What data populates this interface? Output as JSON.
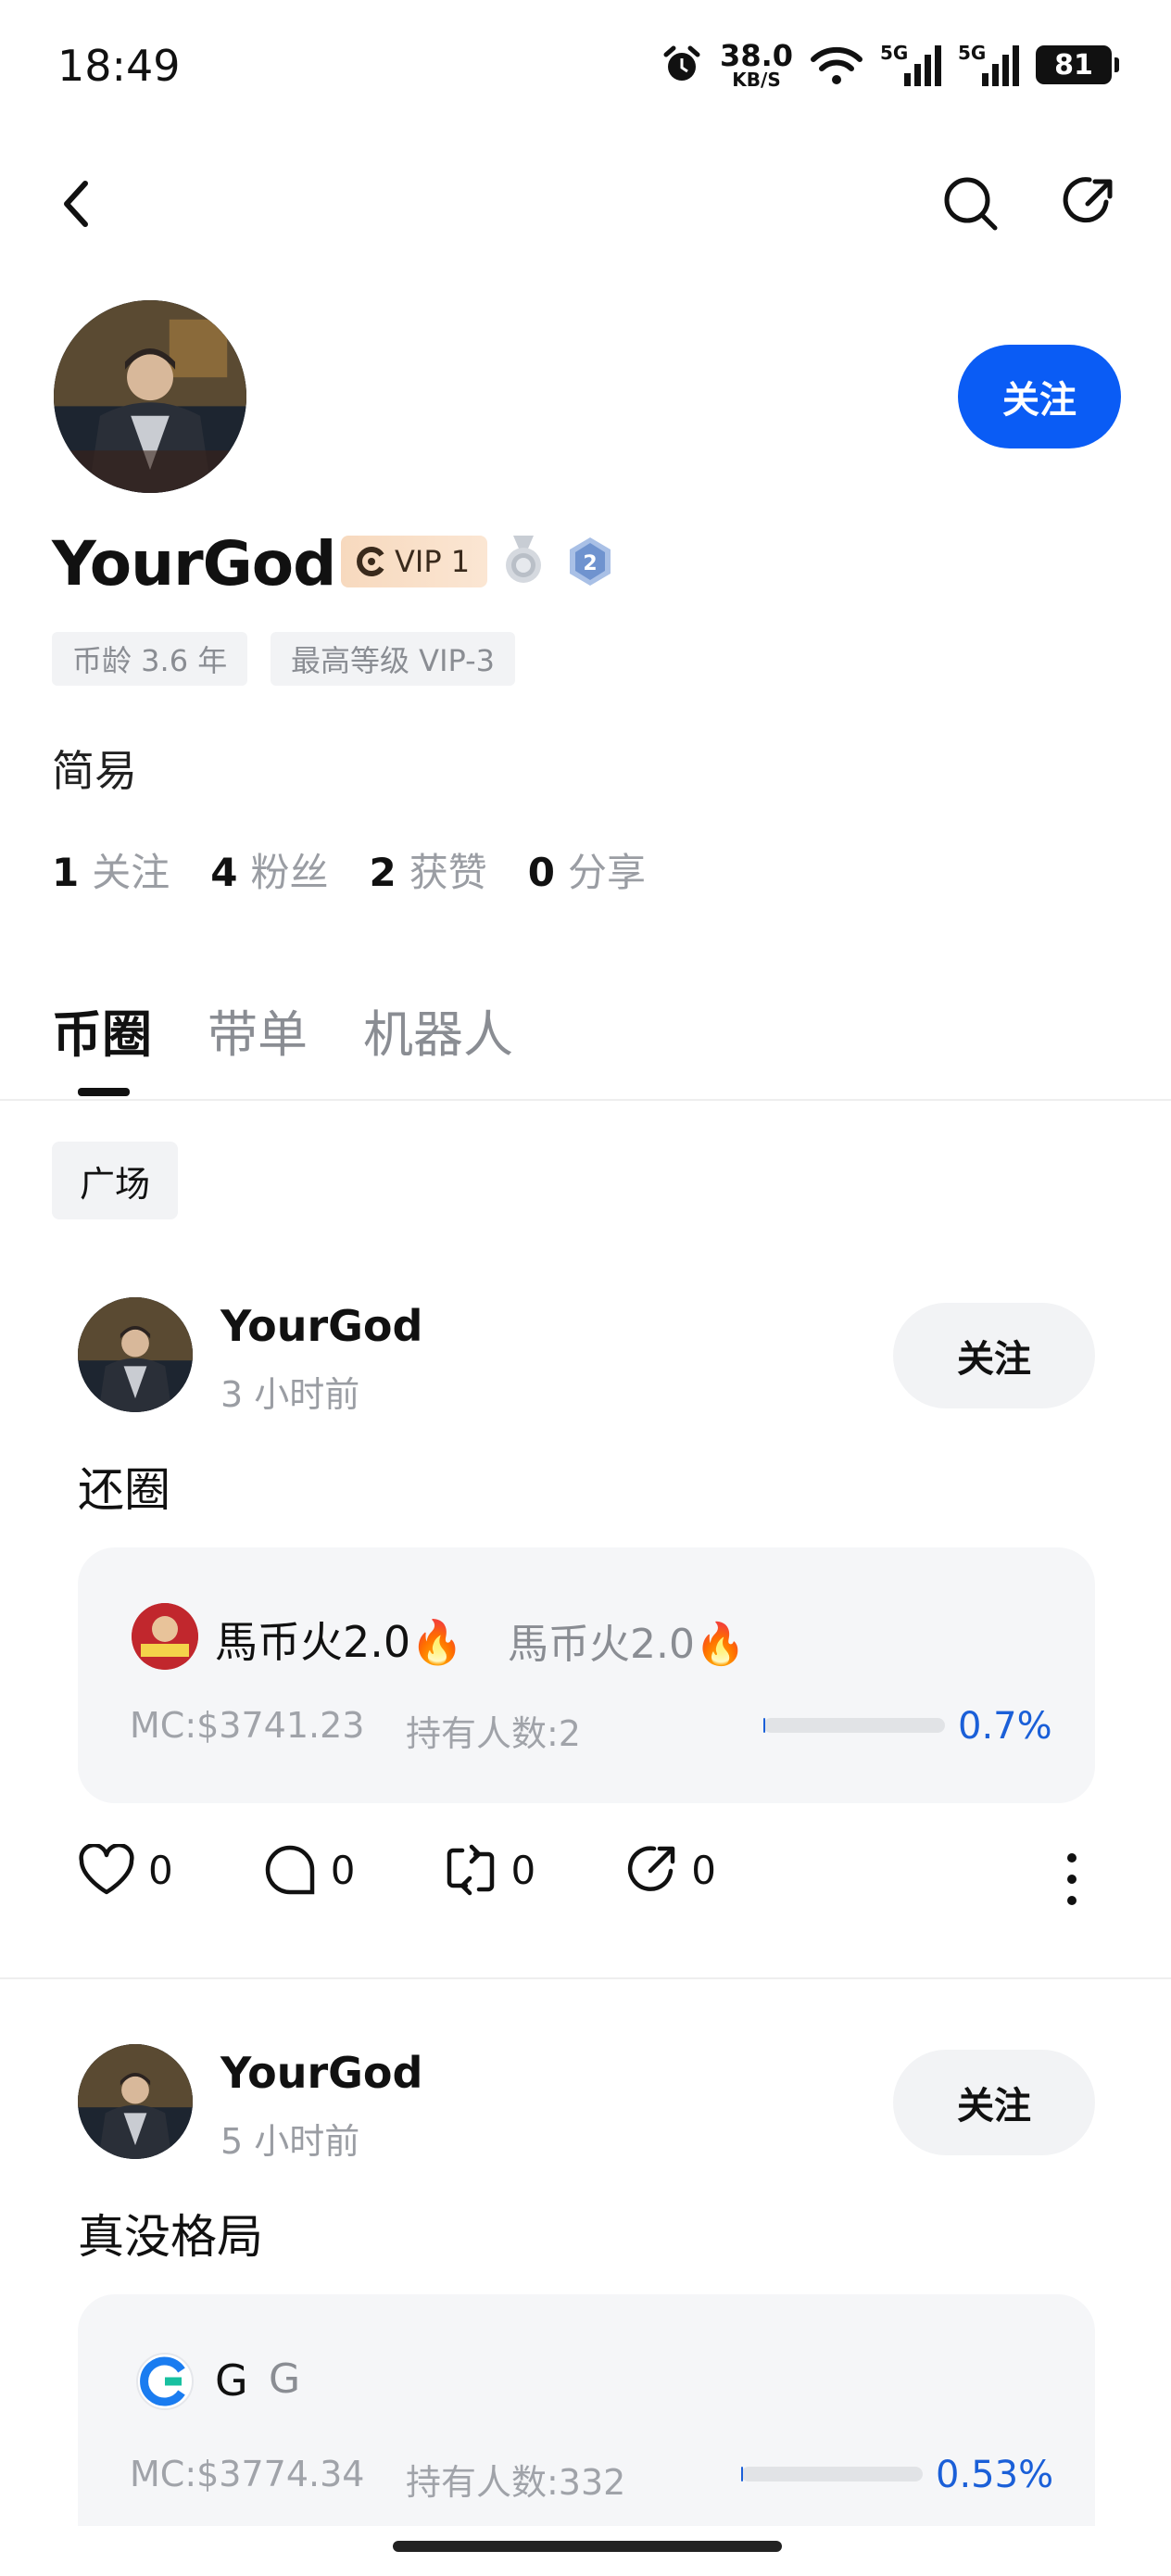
{
  "status_bar": {
    "time": "18:49",
    "net_speed": "38.0",
    "net_unit": "KB/S",
    "signal1": "5G",
    "signal2": "5G",
    "battery": "81"
  },
  "profile": {
    "username": "YourGod",
    "vip_label": "VIP 1",
    "level_badge": "2",
    "tags": [
      "币龄 3.6 年",
      "最高等级 VIP-3"
    ],
    "bio": "简易",
    "follow_label": "关注",
    "stats": [
      {
        "num": "1",
        "label": "关注"
      },
      {
        "num": "4",
        "label": "粉丝"
      },
      {
        "num": "2",
        "label": "获赞"
      },
      {
        "num": "0",
        "label": "分享"
      }
    ]
  },
  "tabs": [
    {
      "label": "币圈"
    },
    {
      "label": "带单"
    },
    {
      "label": "机器人"
    }
  ],
  "filter_chip": "广场",
  "posts": [
    {
      "author": "YourGod",
      "time": "3 小时前",
      "follow_label": "关注",
      "text": "还圈",
      "token": {
        "name": "馬币火2.0🔥",
        "symbol": "馬币火2.0🔥",
        "mc": "MC:$3741.23",
        "holders": "持有人数:2",
        "pct": "0.7%",
        "progress": 0.007
      },
      "counts": {
        "likes": "0",
        "comments": "0",
        "reposts": "0",
        "shares": "0"
      }
    },
    {
      "author": "YourGod",
      "time": "5 小时前",
      "follow_label": "关注",
      "text": "真没格局",
      "token": {
        "name": "G",
        "symbol": "G",
        "mc": "MC:$3774.34",
        "holders": "持有人数:332",
        "pct": "0.53%",
        "progress": 0.0053
      }
    }
  ],
  "colors": {
    "accent": "#0a5cf5",
    "percent": "#1a5fd8",
    "muted": "#9a9da3"
  }
}
